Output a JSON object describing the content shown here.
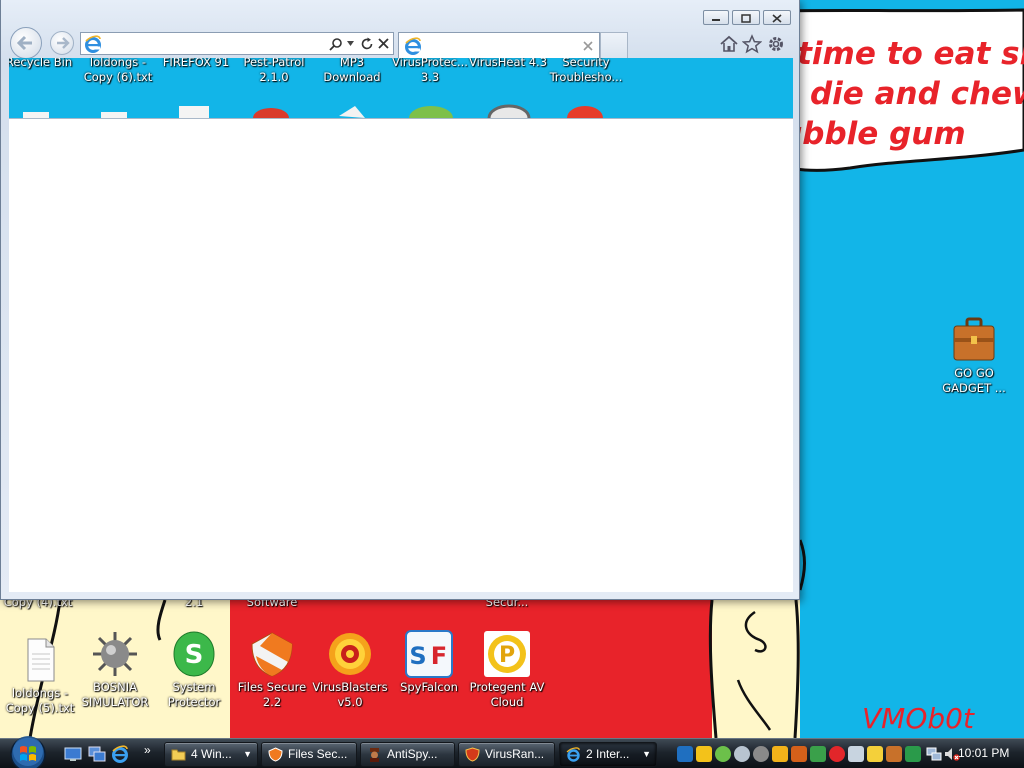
{
  "wallpaper": {
    "lines": [
      "It's time to eat shit",
      "and die and chew",
      "bubble gum"
    ],
    "signature": "VMOb0t",
    "colors": {
      "sky": "#12b5e8",
      "red": "#e8232a",
      "cream": "#fff7c9"
    }
  },
  "desktop_icons": [
    {
      "name": "icon-loldongs-copy-5",
      "label": "loldongs - Copy (5).txt"
    },
    {
      "name": "icon-bosnia-simulator",
      "label": "BOSNIA SIMULATOR"
    },
    {
      "name": "icon-system-protector",
      "label": "System Protector"
    },
    {
      "name": "icon-files-secure",
      "label": "Files Secure 2.2"
    },
    {
      "name": "icon-virusblasters",
      "label": "VirusBlasters v5.0"
    },
    {
      "name": "icon-spyfalcon",
      "label": "SpyFalcon"
    },
    {
      "name": "icon-protegent",
      "label": "Protegent  AV Cloud"
    },
    {
      "name": "icon-go-go-gadget",
      "label": "GO GO GADGET ..."
    }
  ],
  "partial_labels": {
    "top_row": [
      "Recycle Bin",
      "loldongs - Copy (6).txt",
      "FIREFOX 91",
      "Pest-Patrol 2.1.0",
      "MP3 Download",
      "VirusProtec... 3.3",
      "VirusHeat 4.3",
      "Security Troublesho..."
    ],
    "bottom_row": [
      "Copy (4).txt",
      "2.1",
      "Software",
      "Secur..."
    ]
  },
  "browser": {
    "address_value": "",
    "tab_title": "",
    "buttons": {
      "minimize": "minimize",
      "maximize": "maximize",
      "close": "close"
    }
  },
  "taskbar": {
    "buttons": [
      {
        "label": "4 Win...",
        "has_arrow": true
      },
      {
        "label": "Files Sec...",
        "has_arrow": false
      },
      {
        "label": "AntiSpy...",
        "has_arrow": false
      },
      {
        "label": "VirusRan...",
        "has_arrow": false
      },
      {
        "label": "2 Inter...",
        "has_arrow": true
      }
    ],
    "clock": "10:01 PM"
  }
}
